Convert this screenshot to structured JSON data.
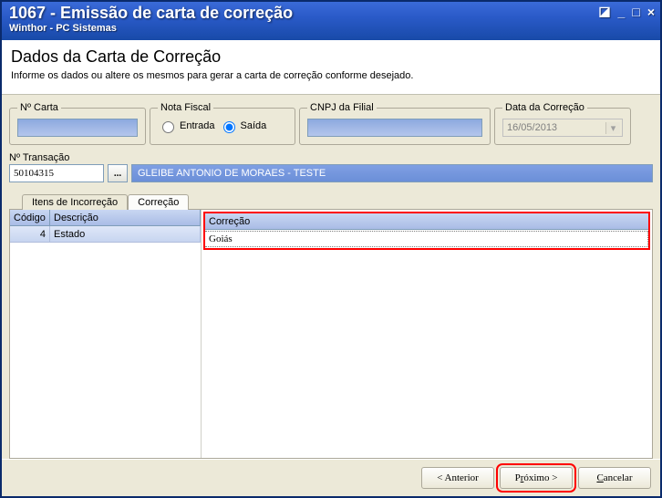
{
  "window": {
    "title": "1067 - Emissão de carta de correção",
    "subtitle": "Winthor - PC Sistemas"
  },
  "header": {
    "title": "Dados da Carta de Correção",
    "description": "Informe os dados ou altere os mesmos para gerar a carta de correção conforme desejado."
  },
  "groups": {
    "carta": {
      "legend": "Nº Carta",
      "value": ""
    },
    "nota": {
      "legend": "Nota Fiscal",
      "entrada_label": "Entrada",
      "saida_label": "Saída"
    },
    "cnpj": {
      "legend": "CNPJ da Filial",
      "value": ""
    },
    "data": {
      "legend": "Data da Correção",
      "value": "16/05/2013"
    }
  },
  "transacao": {
    "label": "Nº Transação",
    "value": "50104315",
    "lookup": "...",
    "display": "GLEIBE ANTONIO DE MORAES - TESTE"
  },
  "tabs": {
    "incorrecao": "Itens de Incorreção",
    "correcao": "Correção"
  },
  "grid": {
    "col_codigo": "Código",
    "col_descricao": "Descrição",
    "col_correcao": "Correção",
    "rows": [
      {
        "codigo": "4",
        "descricao": "Estado",
        "correcao": "Goiás"
      }
    ]
  },
  "footer": {
    "anterior": "< Anterior",
    "proximo_pre": "P",
    "proximo_u": "r",
    "proximo_post": "óximo >",
    "cancelar_u": "C",
    "cancelar_post": "ancelar"
  }
}
